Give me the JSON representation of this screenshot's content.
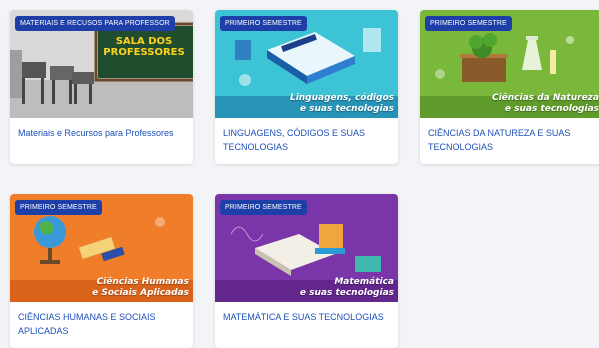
{
  "cards": [
    {
      "badge": "MATERIAIS E RECUSOS PARA PROFESSOR",
      "board_line1": "SALA DOS",
      "board_line2": "PROFESSORES",
      "title": "Materiais e Recursos para Professores"
    },
    {
      "badge": "PRIMEIRO SEMESTRE",
      "banner_line1": "Linguagens, códigos",
      "banner_line2": "e suas tecnologias",
      "title": "LINGUAGENS, CÓDIGOS E SUAS TECNOLOGIAS"
    },
    {
      "badge": "PRIMEIRO SEMESTRE",
      "banner_line1": "Ciências da Natureza",
      "banner_line2": "e suas tecnologias",
      "title": "CIÊNCIAS DA NATUREZA E SUAS TECNOLOGIAS"
    },
    {
      "badge": "PRIMEIRO SEMESTRE",
      "banner_line1": "Ciências Humanas",
      "banner_line2": "e Sociais Aplicadas",
      "title": "CIÊNCIAS HUMANAS E SOCIAIS APLICADAS"
    },
    {
      "badge": "PRIMEIRO SEMESTRE",
      "banner_line1": "Matemática",
      "banner_line2": "e suas tecnologias",
      "title": "MATEMÁTICA E SUAS TECNOLOGIAS"
    }
  ],
  "colors": {
    "badge_bg": "#1f3fa8",
    "title_text": "#1d4fb8",
    "linguagens_bg": "#3cc3d6",
    "natureza_bg": "#79b83a",
    "humanas_bg": "#ef7d2a",
    "matematica_bg": "#7a35a8"
  }
}
